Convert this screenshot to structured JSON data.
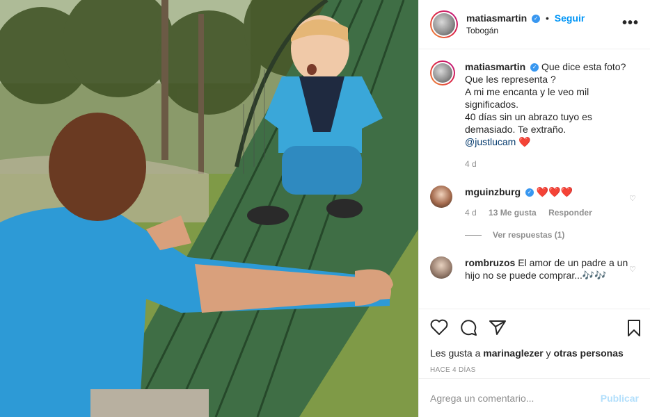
{
  "photo": {
    "description_icon": "photo",
    "colors": {
      "sky": "#c9d8c2",
      "trees": "#4b5e2f",
      "grass": "#7f9a47",
      "slide": "#3d6b3f",
      "shirt": "#2f9fd8"
    }
  },
  "header": {
    "username": "matiasmartin",
    "follow_label": "Seguir",
    "location": "Tobogán",
    "more_label": "•••"
  },
  "caption": {
    "username": "matiasmartin",
    "text_lines": [
      "Que dice esta foto?",
      "Que les representa ?",
      "A mi me encanta y le veo mil",
      "significados.",
      "40 días sin un abrazo tuyo es",
      "demasiado. Te extraño."
    ],
    "mention": "@justlucam",
    "emoji": "❤️",
    "time": "4 d"
  },
  "comments": [
    {
      "username": "mguinzburg",
      "text": "❤️❤️❤️",
      "time": "4 d",
      "likes": "13 Me gusta",
      "reply_label": "Responder",
      "view_replies": "Ver respuestas (1)"
    },
    {
      "username": "rombruzos",
      "text": "El amor de un padre a un hijo no se puede comprar...🎶🎶"
    }
  ],
  "actions": {
    "likes_prefix": "Les gusta a",
    "liked_by": "marinaglezer",
    "likes_joiner": "y",
    "others": "otras personas",
    "time_ago": "HACE 4 DÍAS"
  },
  "add_comment": {
    "placeholder": "Agrega un comentario...",
    "publish_label": "Publicar"
  },
  "brand": {
    "blue": "#0095f6",
    "gray": "#8e8e8e",
    "red": "#ed4956"
  }
}
